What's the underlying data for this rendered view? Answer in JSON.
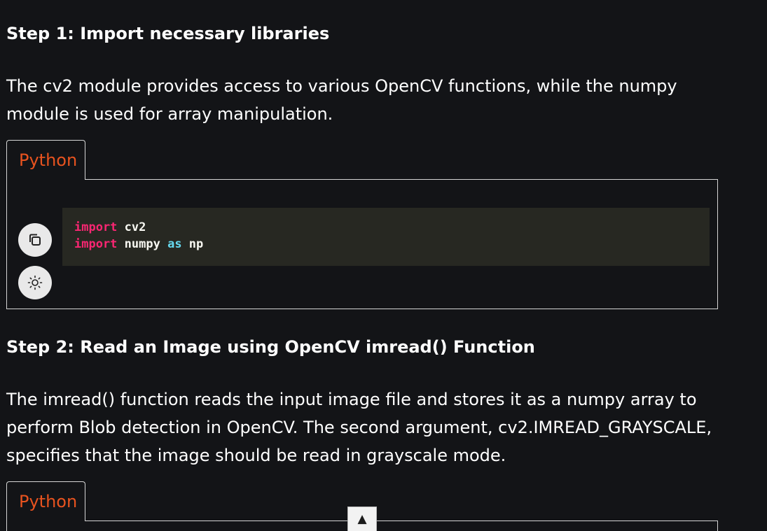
{
  "steps": [
    {
      "heading": "Step 1: Import necessary libraries",
      "description": "The cv2 module provides access to various OpenCV functions, while the numpy module is used for array manipulation.",
      "code_tab": "Python",
      "code_lines": [
        [
          {
            "t": "import",
            "c": "kw"
          },
          {
            "t": " cv2",
            "c": "nm"
          }
        ],
        [
          {
            "t": "import",
            "c": "kw"
          },
          {
            "t": " numpy ",
            "c": "nm"
          },
          {
            "t": "as",
            "c": "kw2"
          },
          {
            "t": " np",
            "c": "nm"
          }
        ]
      ]
    },
    {
      "heading": "Step 2: Read an Image using OpenCV imread() Function",
      "description": "The imread() function reads the input image file and stores it as a numpy array to perform Blob detection in OpenCV. The second argument, cv2.IMREAD_GRAYSCALE, specifies that the image should be read in grayscale mode.",
      "code_tab": "Python"
    }
  ],
  "controls": {
    "copy_icon": "copy-icon",
    "theme_icon": "sun-icon",
    "scroll_top_glyph": "▲"
  },
  "colors": {
    "background": "#131417",
    "tab_label": "#e8531f",
    "code_bg": "#272822",
    "keyword": "#f92672",
    "keyword_alt": "#66d9ef"
  }
}
